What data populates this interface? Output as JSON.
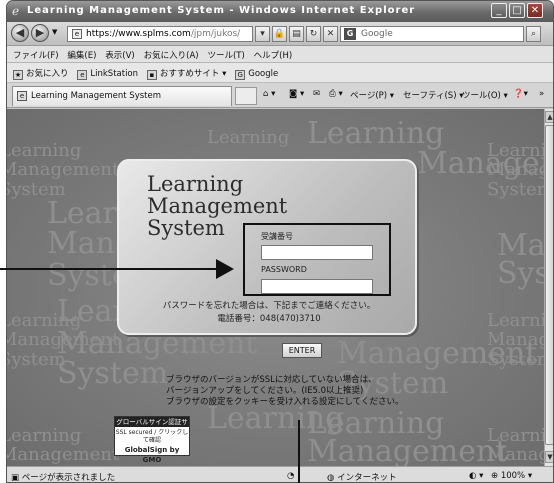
{
  "window": {
    "title": "Learning Management System - Windows Internet Explorer",
    "controls": [
      "_",
      "□",
      "✕"
    ]
  },
  "address": {
    "url_host": "https://www.splms.com",
    "url_rest": "/jpm/jukos/",
    "search_placeholder": "Google",
    "search_logo": "G"
  },
  "menu": [
    "ファイル(F)",
    "編集(E)",
    "表示(V)",
    "お気に入り(A)",
    "ツール(T)",
    "ヘルプ(H)"
  ],
  "favorites": {
    "label": "お気に入り",
    "items": [
      "LinkStation",
      "おすすめサイト ▾",
      "Google"
    ]
  },
  "tab": {
    "title": "Learning Management System"
  },
  "commands": {
    "page": "ページ(P) ▾",
    "safety": "セーフティ(S) ▾",
    "tools": "ツール(O) ▾"
  },
  "background_words": [
    "Learning",
    "Management",
    "System"
  ],
  "login": {
    "logo_line1": "Learning",
    "logo_line2": "Management",
    "logo_line3": "System",
    "id_label": "受講番号",
    "password_label": "PASSWORD",
    "forgot_note": "パスワードを忘れた場合は、下記までご連絡ください。",
    "phone_note": "電話番号：048(470)3710",
    "enter_label": "ENTER"
  },
  "notice": {
    "line1": "ブラウザのバージョンがSSLに対応していない場合は、",
    "line2": "バージョンアップをしてください。(IE5.0以上推奨)",
    "line3": "ブラウザの設定をクッキーを受け入れる設定にしてください。"
  },
  "globalsign": {
    "top": "グローバルサイン認証サイト",
    "mid": "SSL secured / クリックして確認",
    "bottom": "GlobalSign by GMO"
  },
  "status": {
    "text": "ページが表示されました",
    "zone": "インターネット",
    "zoom": "100%"
  }
}
